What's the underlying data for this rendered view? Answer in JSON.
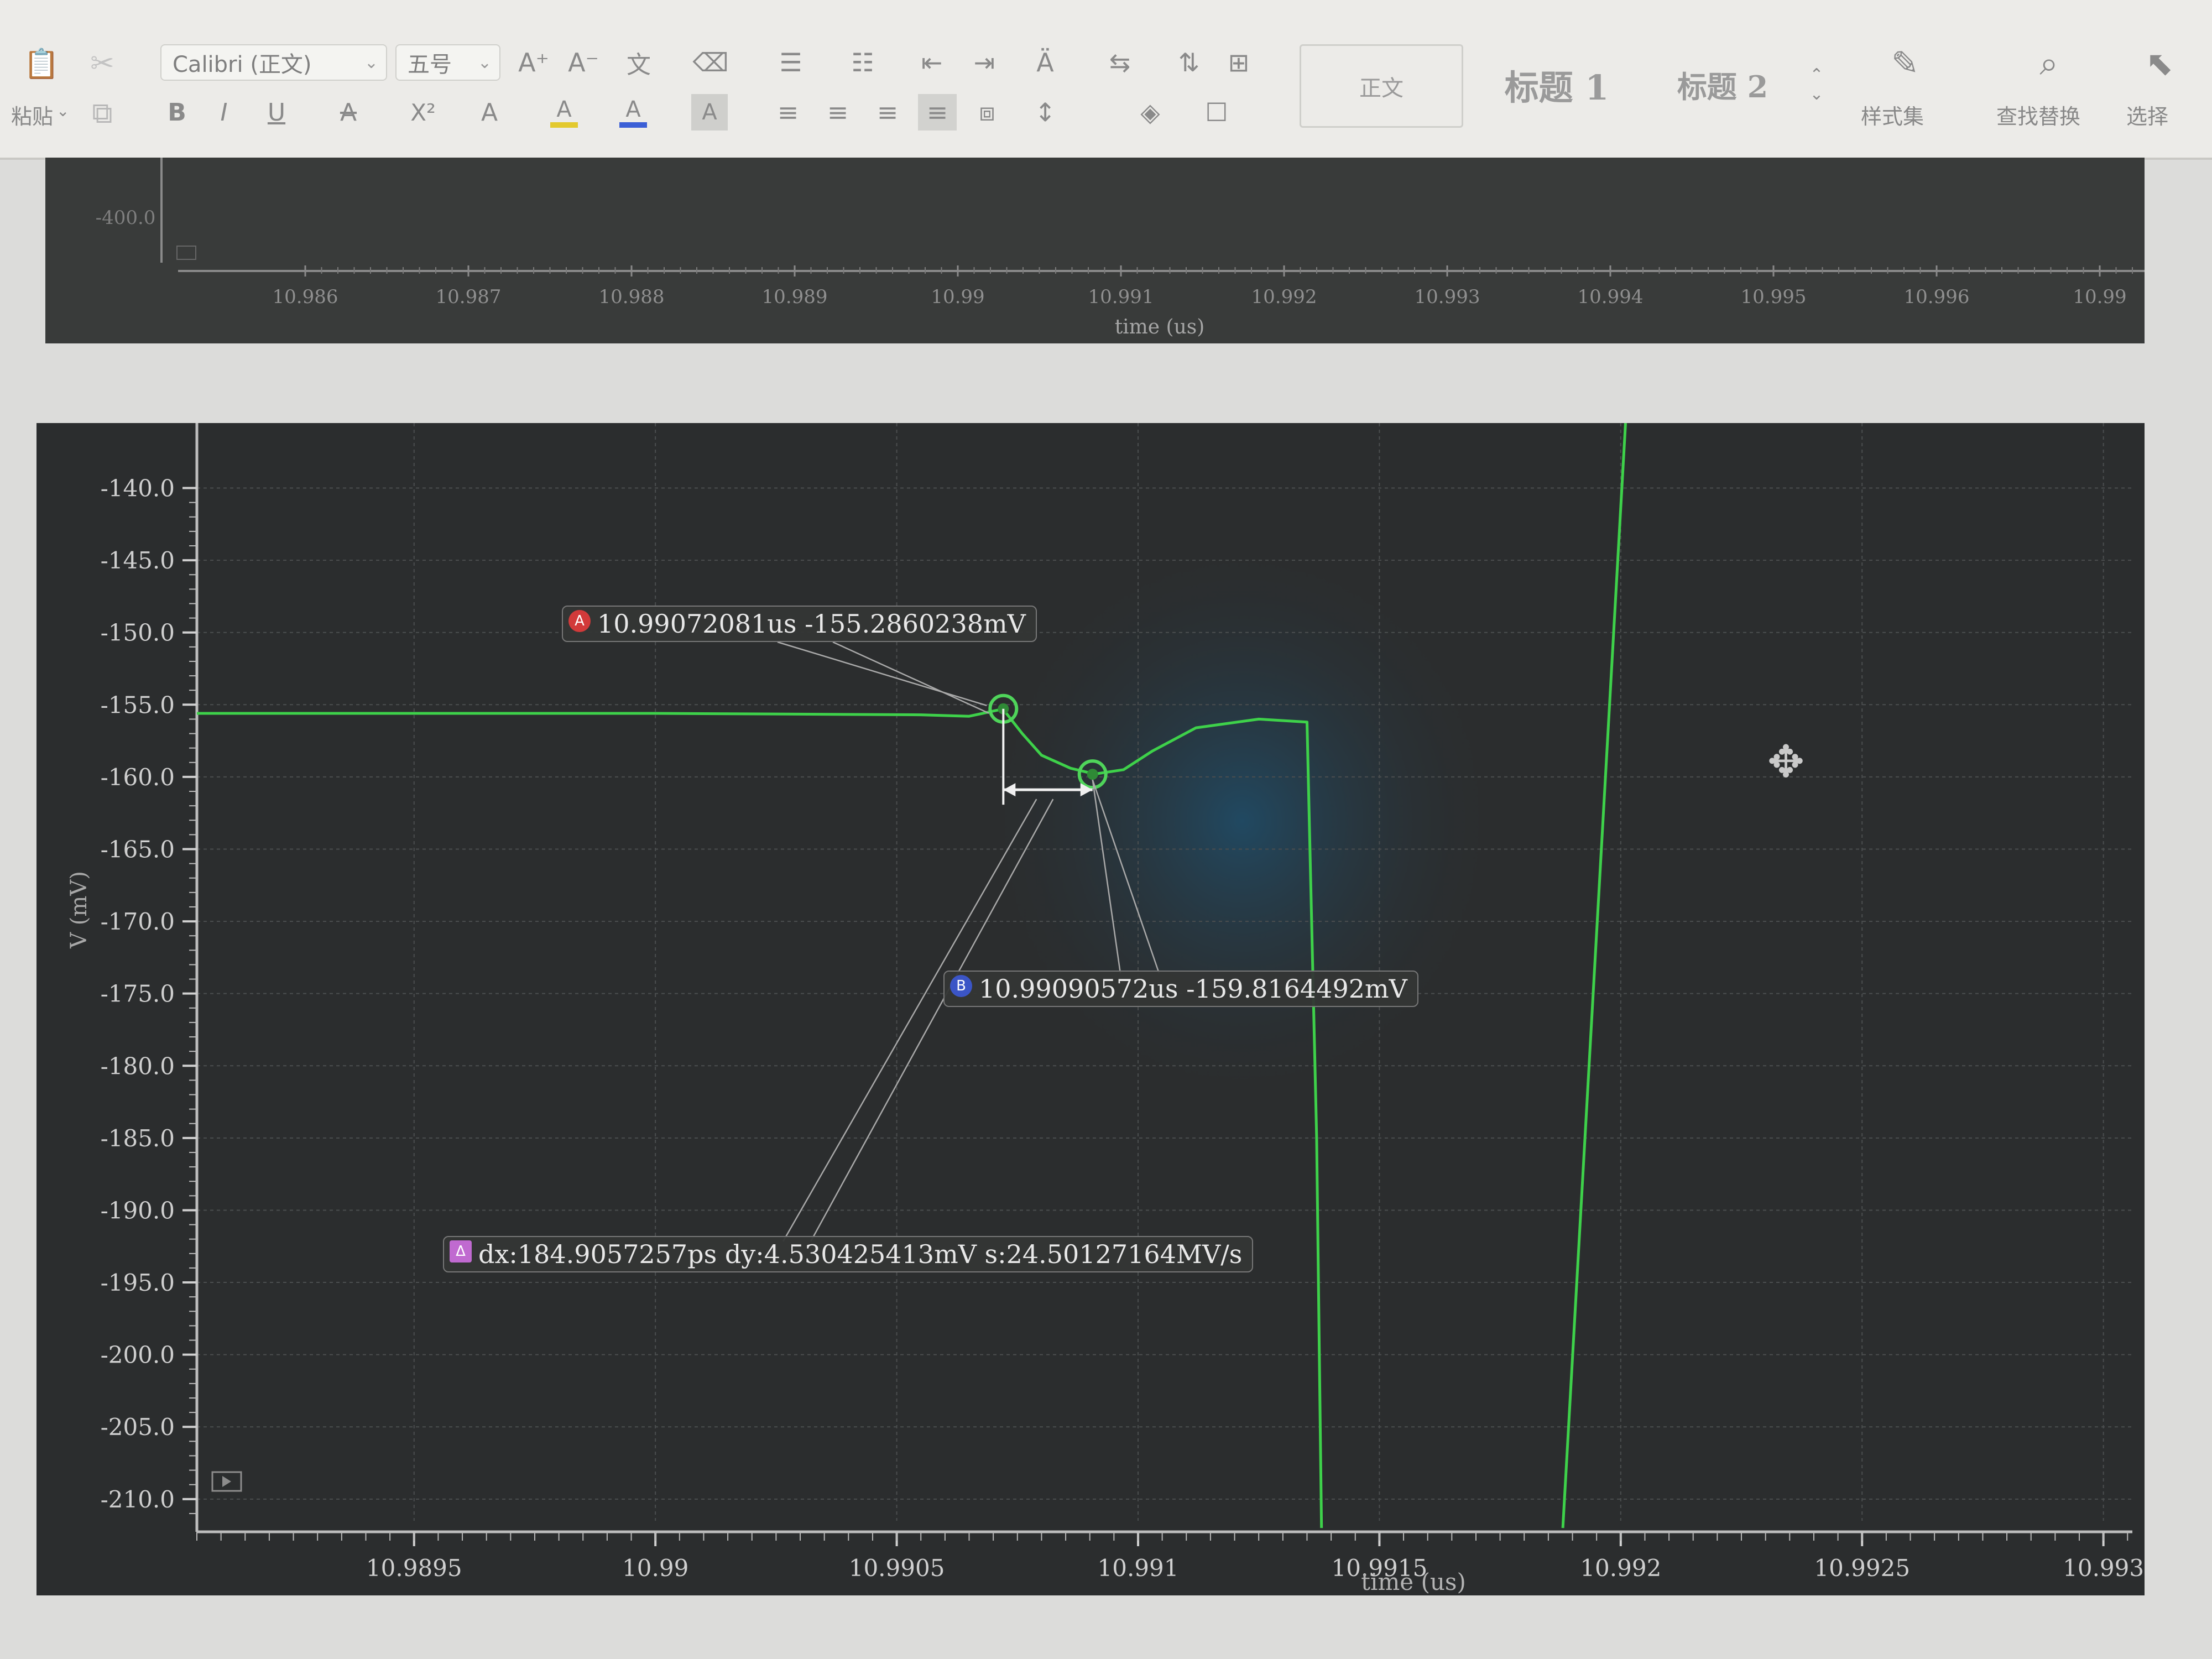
{
  "ribbon": {
    "paste_label": "粘贴",
    "font_name": "Calibri (正文)",
    "font_size": "五号",
    "styles": {
      "normal": "正文",
      "heading1": "标题 1",
      "heading2": "标题 2"
    },
    "style_set_label": "样式集",
    "find_replace_label": "查找替换",
    "select_label": "选择",
    "format_buttons": {
      "bold": "B",
      "italic": "I",
      "underline": "U",
      "strike": "A",
      "superscript": "X²",
      "char_effect": "A",
      "highlight": "A",
      "font_color": "A",
      "char_shade": "A"
    },
    "colors": {
      "highlight": "#e3c92e",
      "font_color": "#3b5fd6"
    }
  },
  "top_plot": {
    "y_tick": "-400.0",
    "x_ticks": [
      "10.986",
      "10.987",
      "10.988",
      "10.989",
      "10.99",
      "10.991",
      "10.992",
      "10.993",
      "10.994",
      "10.995",
      "10.996",
      "10.99"
    ],
    "x_label": "time (us)"
  },
  "main_plot": {
    "y_label": "V (mV)",
    "x_label": "time (us)",
    "cursor_a": {
      "badge": "A",
      "text": "10.99072081us -155.2860238mV"
    },
    "cursor_b": {
      "badge": "B",
      "text": "10.99090572us -159.8164492mV"
    },
    "delta": {
      "badge": "Δ",
      "text": "dx:184.9057257ps dy:4.530425413mV s:24.50127164MV/s"
    }
  },
  "chart_data": {
    "type": "line",
    "xlabel": "time (us)",
    "ylabel": "V (mV)",
    "xlim": [
      10.98905,
      10.99306
    ],
    "ylim": [
      -211.5,
      -135.5
    ],
    "x_ticks": [
      10.9895,
      10.99,
      10.9905,
      10.991,
      10.9915,
      10.992,
      10.9925,
      10.993
    ],
    "x_tick_labels": [
      "10.9895",
      "10.99",
      "10.9905",
      "10.991",
      "10.9915",
      "10.992",
      "10.9925",
      "10.993"
    ],
    "y_ticks": [
      -140,
      -145,
      -150,
      -155,
      -160,
      -165,
      -170,
      -175,
      -180,
      -185,
      -190,
      -195,
      -200,
      -205,
      -210
    ],
    "y_tick_labels": [
      "-140.0",
      "-145.0",
      "-150.0",
      "-155.0",
      "-160.0",
      "-165.0",
      "-170.0",
      "-175.0",
      "-180.0",
      "-185.0",
      "-190.0",
      "-195.0",
      "-200.0",
      "-205.0",
      "-210.0"
    ],
    "grid": true,
    "line_color": "#3ed14a",
    "series": [
      {
        "x": [
          10.98905,
          10.99,
          10.99055,
          10.99065,
          10.99072,
          10.99076,
          10.9908,
          10.99086,
          10.99091,
          10.99097,
          10.99103,
          10.99112,
          10.99125,
          10.99135,
          10.99137,
          10.99138
        ],
        "y": [
          -155.6,
          -155.6,
          -155.7,
          -155.8,
          -155.3,
          -157.0,
          -158.5,
          -159.4,
          -159.8,
          -159.5,
          -158.2,
          -156.6,
          -156.0,
          -156.2,
          -185.0,
          -212.0
        ]
      },
      {
        "x": [
          10.99188,
          10.99201
        ],
        "y": [
          -212.0,
          -135.5
        ]
      }
    ],
    "cursors": [
      {
        "name": "A",
        "x": 10.99072081,
        "y": -155.2860238
      },
      {
        "name": "B",
        "x": 10.99090572,
        "y": -159.8164492
      }
    ]
  }
}
